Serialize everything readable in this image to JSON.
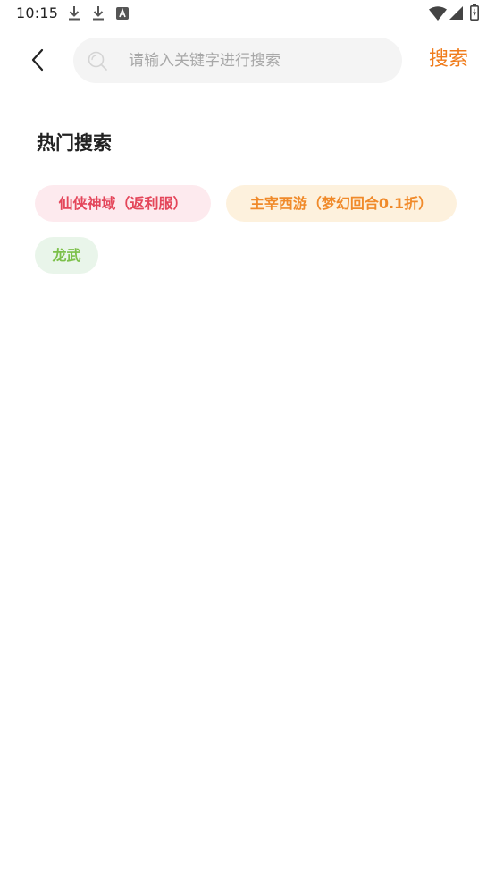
{
  "status_bar": {
    "time": "10:15",
    "icons": [
      "download-icon",
      "download-icon",
      "keyboard-a-icon",
      "wifi-icon",
      "signal-icon",
      "battery-icon"
    ]
  },
  "header": {
    "back_icon": "chevron-left-icon",
    "search": {
      "icon": "search-icon",
      "value": "",
      "placeholder": "请输入关键字进行搜索"
    },
    "search_button_label": "搜索"
  },
  "hot_search": {
    "title": "热门搜索",
    "tags": [
      {
        "label": "仙侠神域（返利服）",
        "color": "#e4465a",
        "background": "#fdeaee"
      },
      {
        "label": "主宰西游（梦幻回合0.1折）",
        "color": "#f08a2a",
        "background": "#fdf1dd"
      },
      {
        "label": "龙武",
        "color": "#7cc04a",
        "background": "#e9f5ea"
      }
    ]
  },
  "colors": {
    "accent": "#f07c1c",
    "text_primary": "#222222",
    "placeholder": "#a8a8a8",
    "search_bg": "#f4f4f4"
  }
}
